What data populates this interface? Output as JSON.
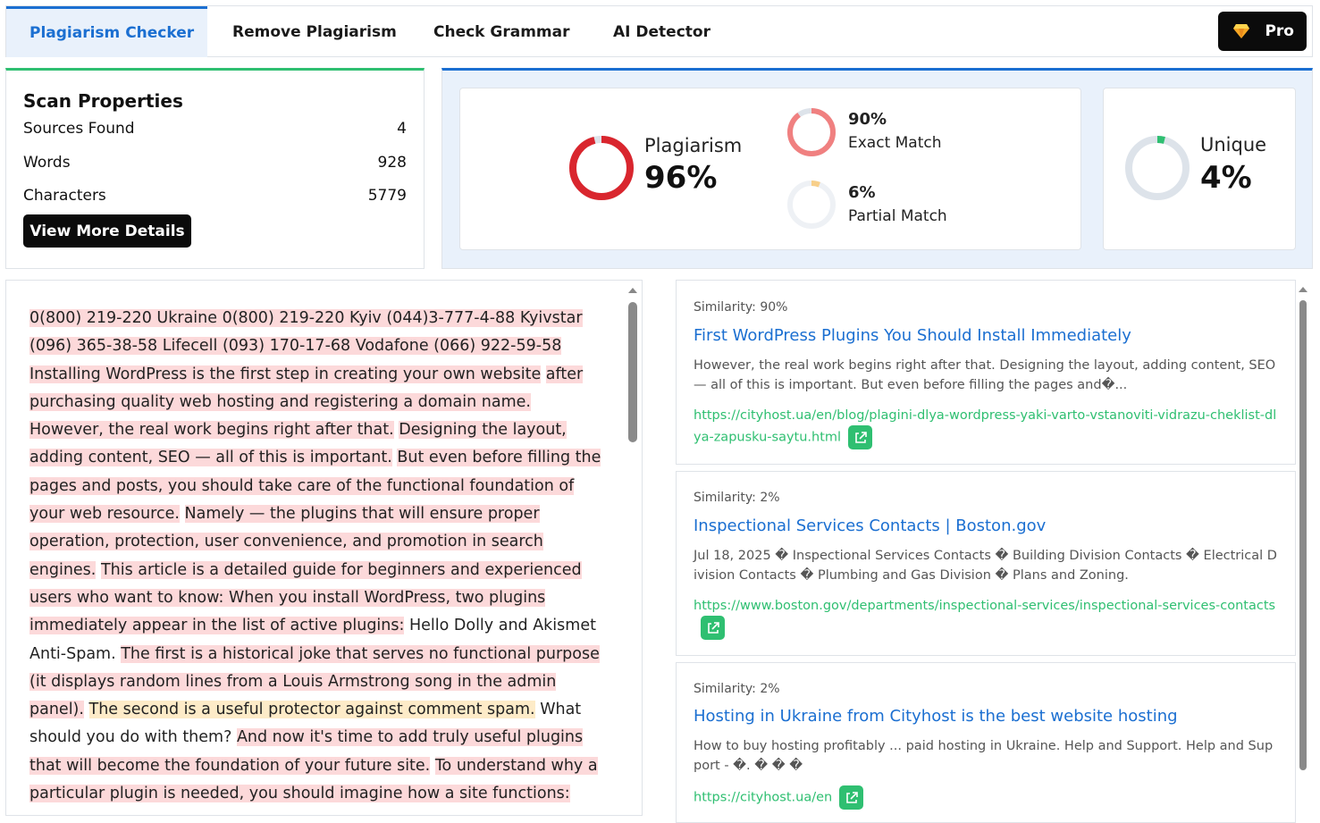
{
  "tabs": [
    {
      "label": "Plagiarism Checker",
      "active": true
    },
    {
      "label": "Remove Plagiarism",
      "active": false
    },
    {
      "label": "Check Grammar",
      "active": false
    },
    {
      "label": "AI Detector",
      "active": false
    }
  ],
  "pro_label": "Pro",
  "scan": {
    "title": "Scan Properties",
    "rows": [
      {
        "label": "Sources Found",
        "value": "4"
      },
      {
        "label": "Words",
        "value": "928"
      },
      {
        "label": "Characters",
        "value": "5779"
      }
    ],
    "details_button": "View More Details"
  },
  "stats": {
    "plagiarism": {
      "label": "Plagiarism",
      "value": "96%",
      "fraction": 0.96
    },
    "exact": {
      "value": "90%",
      "label": "Exact Match",
      "fraction": 0.9
    },
    "partial": {
      "value": "6%",
      "label": "Partial Match",
      "fraction": 0.06
    },
    "unique": {
      "label": "Unique",
      "value": "4%",
      "fraction": 0.04
    },
    "colors": {
      "plagiarism": "#d9262e",
      "exact": "#f08080",
      "partial": "#f7cf8a",
      "unique": "#2fbf71",
      "track": "#dde3ea"
    }
  },
  "text_segments": [
    {
      "text": " 0(800) 219-220 Ukraine 0(800) 219-220 Kyiv (044)3-777-4-88 Kyivstar (096) 365-38-58 Lifecell (093) 170-17-68 Vodafone (066) 922-59-58  Installing WordPress is the first step in creating your own website",
      "hl": "red"
    },
    {
      "text": " ",
      "hl": "none"
    },
    {
      "text": "after purchasing quality web hosting and registering a domain name.",
      "hl": "red"
    },
    {
      "text": " ",
      "hl": "none"
    },
    {
      "text": "However, the real work begins right after that.",
      "hl": "red"
    },
    {
      "text": " ",
      "hl": "none"
    },
    {
      "text": "Designing the layout, adding content, SEO — all of this is important.",
      "hl": "red"
    },
    {
      "text": " ",
      "hl": "none"
    },
    {
      "text": "But even before filling the pages and posts, you should take care of the functional foundation of your web resource.",
      "hl": "red"
    },
    {
      "text": " ",
      "hl": "none"
    },
    {
      "text": "Namely — the plugins that will ensure proper operation, protection, user convenience, and promotion in search engines.",
      "hl": "red"
    },
    {
      "text": " ",
      "hl": "none"
    },
    {
      "text": "This article is a detailed guide for beginners and experienced users who want to know: When you install WordPress, two plugins immediately appear in the list of active plugins:",
      "hl": "red"
    },
    {
      "text": " Hello Dolly and Akismet Anti-Spam. ",
      "hl": "none"
    },
    {
      "text": "The first is a historical joke that serves no functional purpose (it displays random lines from a Louis Armstrong song in the admin panel).",
      "hl": "red"
    },
    {
      "text": " ",
      "hl": "none"
    },
    {
      "text": "The second is a useful protector against comment spam.",
      "hl": "yellow"
    },
    {
      "text": " What should you do with them? ",
      "hl": "none"
    },
    {
      "text": "And now it's time to add truly useful plugins that will become the foundation of your future site.",
      "hl": "red"
    },
    {
      "text": " ",
      "hl": "none"
    },
    {
      "text": "To understand why a particular plugin is needed, you should imagine how a site functions:",
      "hl": "red"
    }
  ],
  "sources": [
    {
      "similarity": "Similarity: 90%",
      "title": "First WordPress Plugins You Should Install Immediately",
      "snippet": "However, the real work begins right after that. Designing the layout, adding content, SEO — all of this is important. But even before filling the pages and�...",
      "url": "https://cityhost.ua/en/blog/plagini-dlya-wordpress-yaki-varto-vstanoviti-vidrazu-cheklist-dlya-zapusku-saytu.html"
    },
    {
      "similarity": "Similarity: 2%",
      "title": "Inspectional Services Contacts | Boston.gov",
      "snippet": "Jul 18, 2025 � Inspectional Services Contacts � Building Division Contacts � Electrical Division Contacts � Plumbing and Gas Division � Plans and Zoning.",
      "url": "https://www.boston.gov/departments/inspectional-services/inspectional-services-contacts"
    },
    {
      "similarity": "Similarity: 2%",
      "title": "Hosting in Ukraine from Cityhost is the best website hosting",
      "snippet": "How to buy hosting profitably ... paid hosting in Ukraine. Help and Support. Help and Support - �. � � �",
      "url": "https://cityhost.ua/en"
    }
  ]
}
